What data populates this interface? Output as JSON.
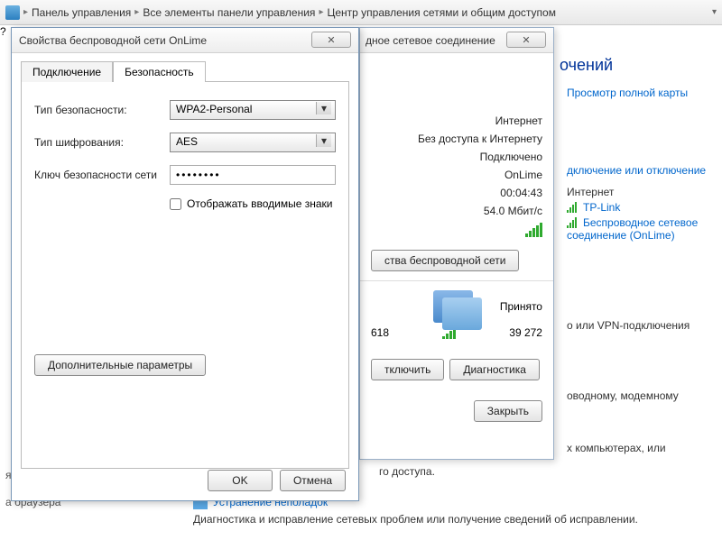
{
  "breadcrumb": {
    "items": [
      "Панель управления",
      "Все элементы панели управления",
      "Центр управления сетями и общим доступом"
    ]
  },
  "bg": {
    "heading_suffix": "очений",
    "view_map": "Просмотр полной карты",
    "conn_or_disc": "дключение или отключение",
    "internet_label": "Интернет",
    "net1": "TP-Link",
    "net2": "Беспроводное сетевое соединение (OnLime)",
    "vpn": "о или VPN-подключения",
    "modem": "оводному, модемному",
    "comps": "х компьютерах, или",
    "access": "го доступа.",
    "troubleshoot": "Устранение неполадок",
    "diag_text": "Диагностика и исправление сетевых проблем или получение сведений об исправлении.",
    "side1": "я группа",
    "side2": "а браузера"
  },
  "props": {
    "title": "Свойства беспроводной сети OnLime",
    "tab_connection": "Подключение",
    "tab_security": "Безопасность",
    "lbl_sectype": "Тип безопасности:",
    "val_sectype": "WPA2-Personal",
    "lbl_enc": "Тип шифрования:",
    "val_enc": "AES",
    "lbl_key": "Ключ безопасности сети",
    "val_key": "••••••••",
    "chk_show": "Отображать вводимые знаки",
    "btn_adv": "Дополнительные параметры",
    "btn_ok": "OK",
    "btn_cancel": "Отмена"
  },
  "status": {
    "title": "дное сетевое соединение",
    "lbl_internet": "Интернет",
    "lbl_noaccess": "Без доступа к Интернету",
    "lbl_connected": "Подключено",
    "ssid": "OnLime",
    "duration": "00:04:43",
    "speed": "54.0 Мбит/с",
    "btn_wprops": "ства беспроводной сети",
    "activity_recv": "Принято",
    "sent": "618",
    "recv": "39 272",
    "btn_disc": "тключить",
    "btn_diag": "Диагностика",
    "btn_close": "Закрыть"
  }
}
